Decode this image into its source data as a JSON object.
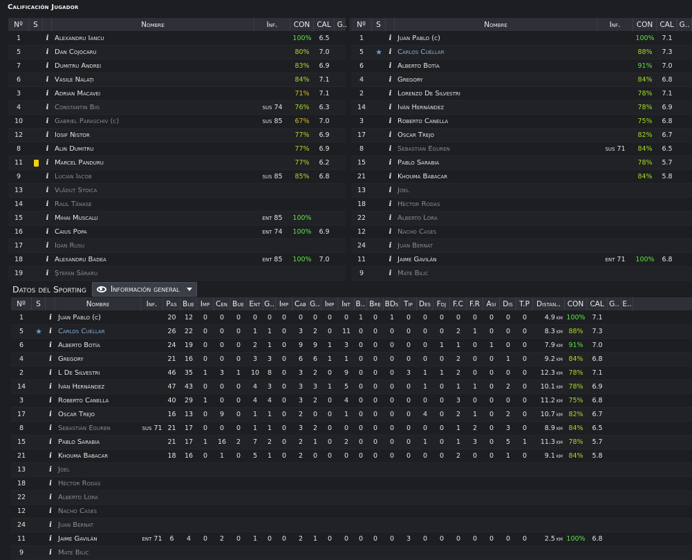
{
  "top_title": "Calificación Jugador",
  "bottom_title": "Datos del Sporting",
  "view_select": "Información general",
  "left_headers": [
    "Nº",
    "S",
    "",
    "Nombre",
    "Inf.",
    "CON",
    "CAL",
    "G.."
  ],
  "left_rows": [
    {
      "n": "1",
      "s": "",
      "name": "Alexandru Iancu",
      "inf": "",
      "con": "100%",
      "cal": "6.5",
      "cc": "c-green",
      "fade": false
    },
    {
      "n": "5",
      "s": "",
      "name": "Dan Cojocaru",
      "inf": "",
      "con": "80%",
      "cal": "7.0",
      "cc": "c-lime",
      "fade": false
    },
    {
      "n": "7",
      "s": "",
      "name": "Dumitru Andrei",
      "inf": "",
      "con": "83%",
      "cal": "6.9",
      "cc": "c-lime",
      "fade": false
    },
    {
      "n": "6",
      "s": "",
      "name": "Vasile Nalați",
      "inf": "",
      "con": "84%",
      "cal": "7.1",
      "cc": "c-lime",
      "fade": false
    },
    {
      "n": "3",
      "s": "",
      "name": "Adrian Macavei",
      "inf": "",
      "con": "71%",
      "cal": "7.1",
      "cc": "c-yellow",
      "fade": false
    },
    {
      "n": "4",
      "s": "",
      "name": "Constantin Big",
      "inf": "sus 74",
      "con": "76%",
      "cal": "6.3",
      "cc": "c-lime",
      "fade": true
    },
    {
      "n": "10",
      "s": "",
      "name": "Gabriel Paraschiv (c)",
      "inf": "sus 85",
      "con": "67%",
      "cal": "7.0",
      "cc": "c-yellow",
      "fade": true
    },
    {
      "n": "12",
      "s": "",
      "name": "Iosif Nistor",
      "inf": "",
      "con": "77%",
      "cal": "6.9",
      "cc": "c-lime",
      "fade": false
    },
    {
      "n": "8",
      "s": "",
      "name": "Alin Dumitru",
      "inf": "",
      "con": "77%",
      "cal": "6.9",
      "cc": "c-lime",
      "fade": false
    },
    {
      "n": "11",
      "s": "yellow",
      "name": "Marcel Panduru",
      "inf": "",
      "con": "77%",
      "cal": "6.2",
      "cc": "c-lime",
      "fade": false
    },
    {
      "n": "9",
      "s": "",
      "name": "Lucian Iacob",
      "inf": "sus 85",
      "con": "85%",
      "cal": "6.8",
      "cc": "c-lime",
      "fade": true
    },
    {
      "n": "13",
      "s": "",
      "name": "Vlăduț Stoica",
      "inf": "",
      "con": "",
      "cal": "",
      "cc": "",
      "fade": true
    },
    {
      "n": "14",
      "s": "",
      "name": "Raul Tănase",
      "inf": "",
      "con": "",
      "cal": "",
      "cc": "",
      "fade": true
    },
    {
      "n": "15",
      "s": "",
      "name": "Mihai Muscalu",
      "inf": "ent 85",
      "con": "100%",
      "cal": "",
      "cc": "c-green",
      "fade": false
    },
    {
      "n": "16",
      "s": "",
      "name": "Caius Popa",
      "inf": "ent 74",
      "con": "100%",
      "cal": "6.9",
      "cc": "c-green",
      "fade": false
    },
    {
      "n": "17",
      "s": "",
      "name": "Ioan Rusu",
      "inf": "",
      "con": "",
      "cal": "",
      "cc": "",
      "fade": true
    },
    {
      "n": "18",
      "s": "",
      "name": "Alexandru Badea",
      "inf": "ent 85",
      "con": "100%",
      "cal": "7.0",
      "cc": "c-green",
      "fade": false
    },
    {
      "n": "19",
      "s": "",
      "name": "Ștefan Săraru",
      "inf": "",
      "con": "",
      "cal": "",
      "cc": "",
      "fade": true
    }
  ],
  "right_headers": [
    "Nº",
    "S",
    "",
    "Nombre",
    "Inf.",
    "CON",
    "CAL",
    "G.."
  ],
  "right_rows": [
    {
      "n": "1",
      "s": "",
      "name": "Juan Pablo (c)",
      "inf": "",
      "con": "100%",
      "cal": "7.1",
      "cc": "c-green",
      "fade": false
    },
    {
      "n": "5",
      "s": "star",
      "name": "Carlos Cuéllar",
      "inf": "",
      "con": "88%",
      "cal": "7.3",
      "cc": "c-lime",
      "fade": false,
      "blue": true
    },
    {
      "n": "6",
      "s": "",
      "name": "Alberto Botía",
      "inf": "",
      "con": "91%",
      "cal": "7.0",
      "cc": "c-green",
      "fade": false
    },
    {
      "n": "4",
      "s": "",
      "name": "Gregory",
      "inf": "",
      "con": "84%",
      "cal": "6.8",
      "cc": "c-lime",
      "fade": false
    },
    {
      "n": "2",
      "s": "",
      "name": "Lorenzo De Silvestri",
      "inf": "",
      "con": "78%",
      "cal": "7.1",
      "cc": "c-lime",
      "fade": false
    },
    {
      "n": "14",
      "s": "",
      "name": "Iván Hernández",
      "inf": "",
      "con": "78%",
      "cal": "6.9",
      "cc": "c-lime",
      "fade": false
    },
    {
      "n": "3",
      "s": "",
      "name": "Roberto Canella",
      "inf": "",
      "con": "75%",
      "cal": "6.8",
      "cc": "c-lime",
      "fade": false
    },
    {
      "n": "17",
      "s": "",
      "name": "Oscar Trejo",
      "inf": "",
      "con": "82%",
      "cal": "6.7",
      "cc": "c-lime",
      "fade": false
    },
    {
      "n": "8",
      "s": "",
      "name": "Sebastián Eguren",
      "inf": "sus 71",
      "con": "84%",
      "cal": "6.5",
      "cc": "c-lime",
      "fade": true
    },
    {
      "n": "15",
      "s": "",
      "name": "Pablo Sarabia",
      "inf": "",
      "con": "78%",
      "cal": "5.7",
      "cc": "c-lime",
      "fade": false
    },
    {
      "n": "21",
      "s": "",
      "name": "Khouma Babacar",
      "inf": "",
      "con": "84%",
      "cal": "5.8",
      "cc": "c-lime",
      "fade": false
    },
    {
      "n": "13",
      "s": "",
      "name": "Joel",
      "inf": "",
      "con": "",
      "cal": "",
      "cc": "",
      "fade": true
    },
    {
      "n": "18",
      "s": "",
      "name": "Héctor Rodas",
      "inf": "",
      "con": "",
      "cal": "",
      "cc": "",
      "fade": true
    },
    {
      "n": "22",
      "s": "",
      "name": "Alberto Lora",
      "inf": "",
      "con": "",
      "cal": "",
      "cc": "",
      "fade": true
    },
    {
      "n": "12",
      "s": "",
      "name": "Nacho Cases",
      "inf": "",
      "con": "",
      "cal": "",
      "cc": "",
      "fade": true
    },
    {
      "n": "24",
      "s": "",
      "name": "Juan Bernat",
      "inf": "",
      "con": "",
      "cal": "",
      "cc": "",
      "fade": true
    },
    {
      "n": "11",
      "s": "",
      "name": "Jaime Gavilán",
      "inf": "ent 71",
      "con": "100%",
      "cal": "6.8",
      "cc": "c-green",
      "fade": false
    },
    {
      "n": "9",
      "s": "",
      "name": "Mate Bilic",
      "inf": "",
      "con": "",
      "cal": "",
      "cc": "",
      "fade": true
    }
  ],
  "stats_headers": [
    "Nº",
    "S",
    "",
    "Nombre",
    "Inf.",
    "Pas",
    "Bue",
    "Imp",
    "Cen",
    "Bue",
    "Ent",
    "G..",
    "Imp",
    "Cab",
    "G..",
    "Imp",
    "Int",
    "B..",
    "Bre",
    "BDs",
    "Tip",
    "Des",
    "Fdj",
    "F.C",
    "F.R",
    "Asi",
    "Dis",
    "T.P",
    "Distan..",
    "CON",
    "CAL",
    "G..",
    "E.."
  ],
  "stats_rows": [
    {
      "n": "1",
      "s": "",
      "name": "Juan Pablo (c)",
      "inf": "",
      "v": [
        "20",
        "12",
        "0",
        "0",
        "0",
        "0",
        "0",
        "0",
        "0",
        "0",
        "0",
        "0",
        "1",
        "0",
        "1",
        "0",
        "0",
        "0",
        "0",
        "0",
        "0",
        "0",
        "0"
      ],
      "dist": "4.9",
      "con": "100%",
      "cal": "7.1",
      "cc": "c-green",
      "fade": false
    },
    {
      "n": "5",
      "s": "star",
      "name": "Carlos Cuéllar",
      "inf": "",
      "v": [
        "26",
        "22",
        "0",
        "0",
        "0",
        "1",
        "1",
        "0",
        "3",
        "2",
        "0",
        "11",
        "0",
        "0",
        "0",
        "0",
        "0",
        "0",
        "2",
        "1",
        "0",
        "0",
        "0"
      ],
      "dist": "8.3",
      "con": "88%",
      "cal": "7.3",
      "cc": "c-lime",
      "fade": false,
      "blue": true
    },
    {
      "n": "6",
      "s": "",
      "name": "Alberto Botía",
      "inf": "",
      "v": [
        "24",
        "19",
        "0",
        "0",
        "0",
        "2",
        "1",
        "0",
        "9",
        "9",
        "1",
        "3",
        "0",
        "0",
        "0",
        "0",
        "0",
        "1",
        "1",
        "0",
        "1",
        "0",
        "0"
      ],
      "dist": "7.9",
      "con": "91%",
      "cal": "7.0",
      "cc": "c-green",
      "fade": false
    },
    {
      "n": "4",
      "s": "",
      "name": "Gregory",
      "inf": "",
      "v": [
        "21",
        "16",
        "0",
        "0",
        "0",
        "3",
        "3",
        "0",
        "6",
        "6",
        "1",
        "1",
        "0",
        "0",
        "0",
        "0",
        "0",
        "0",
        "2",
        "0",
        "0",
        "1",
        "0"
      ],
      "dist": "9.2",
      "con": "84%",
      "cal": "6.8",
      "cc": "c-lime",
      "fade": false
    },
    {
      "n": "2",
      "s": "",
      "name": "L De Silvestri",
      "inf": "",
      "v": [
        "46",
        "35",
        "1",
        "3",
        "1",
        "10",
        "8",
        "0",
        "3",
        "2",
        "0",
        "9",
        "0",
        "0",
        "0",
        "3",
        "1",
        "1",
        "2",
        "0",
        "0",
        "0",
        "0"
      ],
      "dist": "12.3",
      "con": "78%",
      "cal": "7.1",
      "cc": "c-lime",
      "fade": false
    },
    {
      "n": "14",
      "s": "",
      "name": "Iván Hernández",
      "inf": "",
      "v": [
        "47",
        "43",
        "0",
        "0",
        "0",
        "4",
        "3",
        "0",
        "3",
        "3",
        "1",
        "5",
        "0",
        "0",
        "0",
        "0",
        "1",
        "0",
        "1",
        "1",
        "0",
        "2",
        "0"
      ],
      "dist": "10.1",
      "con": "78%",
      "cal": "6.9",
      "cc": "c-lime",
      "fade": false
    },
    {
      "n": "3",
      "s": "",
      "name": "Roberto Canella",
      "inf": "",
      "v": [
        "40",
        "29",
        "1",
        "0",
        "0",
        "4",
        "4",
        "0",
        "3",
        "2",
        "0",
        "4",
        "0",
        "0",
        "0",
        "0",
        "0",
        "0",
        "3",
        "0",
        "0",
        "0",
        "0"
      ],
      "dist": "11.2",
      "con": "75%",
      "cal": "6.8",
      "cc": "c-lime",
      "fade": false
    },
    {
      "n": "17",
      "s": "",
      "name": "Oscar Trejo",
      "inf": "",
      "v": [
        "16",
        "13",
        "0",
        "9",
        "0",
        "1",
        "1",
        "0",
        "2",
        "0",
        "0",
        "1",
        "0",
        "0",
        "0",
        "0",
        "4",
        "0",
        "2",
        "1",
        "0",
        "2",
        "0"
      ],
      "dist": "10.7",
      "con": "82%",
      "cal": "6.7",
      "cc": "c-lime",
      "fade": false
    },
    {
      "n": "8",
      "s": "",
      "name": "Sebastián Eguren",
      "inf": "sus 71",
      "v": [
        "21",
        "17",
        "0",
        "0",
        "0",
        "1",
        "1",
        "0",
        "3",
        "2",
        "0",
        "0",
        "0",
        "0",
        "0",
        "0",
        "0",
        "0",
        "1",
        "2",
        "0",
        "3",
        "0"
      ],
      "dist": "8.9",
      "con": "84%",
      "cal": "6.5",
      "cc": "c-lime",
      "fade": true
    },
    {
      "n": "15",
      "s": "",
      "name": "Pablo Sarabia",
      "inf": "",
      "v": [
        "21",
        "17",
        "1",
        "16",
        "2",
        "7",
        "2",
        "0",
        "2",
        "1",
        "0",
        "2",
        "0",
        "0",
        "0",
        "0",
        "1",
        "0",
        "1",
        "3",
        "0",
        "5",
        "1"
      ],
      "dist": "11.3",
      "con": "78%",
      "cal": "5.7",
      "cc": "c-lime",
      "fade": false
    },
    {
      "n": "21",
      "s": "",
      "name": "Khouma Babacar",
      "inf": "",
      "v": [
        "18",
        "16",
        "0",
        "1",
        "0",
        "5",
        "1",
        "0",
        "2",
        "0",
        "0",
        "0",
        "0",
        "0",
        "0",
        "0",
        "0",
        "0",
        "2",
        "0",
        "0",
        "1",
        "0"
      ],
      "dist": "9.1",
      "con": "84%",
      "cal": "5.8",
      "cc": "c-lime",
      "fade": false
    },
    {
      "n": "13",
      "s": "",
      "name": "Joel",
      "inf": "",
      "v": [],
      "dist": "",
      "con": "",
      "cal": "",
      "cc": "",
      "fade": true
    },
    {
      "n": "18",
      "s": "",
      "name": "Héctor Rodas",
      "inf": "",
      "v": [],
      "dist": "",
      "con": "",
      "cal": "",
      "cc": "",
      "fade": true
    },
    {
      "n": "22",
      "s": "",
      "name": "Alberto Lora",
      "inf": "",
      "v": [],
      "dist": "",
      "con": "",
      "cal": "",
      "cc": "",
      "fade": true
    },
    {
      "n": "12",
      "s": "",
      "name": "Nacho Cases",
      "inf": "",
      "v": [],
      "dist": "",
      "con": "",
      "cal": "",
      "cc": "",
      "fade": true
    },
    {
      "n": "24",
      "s": "",
      "name": "Juan Bernat",
      "inf": "",
      "v": [],
      "dist": "",
      "con": "",
      "cal": "",
      "cc": "",
      "fade": true
    },
    {
      "n": "11",
      "s": "",
      "name": "Jaime Gavilán",
      "inf": "ent 71",
      "v": [
        "6",
        "4",
        "0",
        "2",
        "0",
        "1",
        "0",
        "0",
        "2",
        "1",
        "0",
        "0",
        "0",
        "0",
        "0",
        "3",
        "0",
        "0",
        "0",
        "0",
        "0",
        "0",
        "0"
      ],
      "dist": "2.5",
      "con": "100%",
      "cal": "6.8",
      "cc": "c-green",
      "fade": false
    },
    {
      "n": "9",
      "s": "",
      "name": "Mate Bilic",
      "inf": "",
      "v": [],
      "dist": "",
      "con": "",
      "cal": "",
      "cc": "",
      "fade": true
    }
  ],
  "dist_unit": "km",
  "info_glyph": "i"
}
